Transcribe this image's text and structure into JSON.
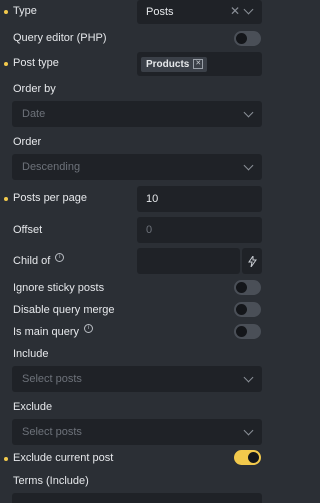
{
  "type": {
    "label": "Type",
    "value": "Posts",
    "clear_icon": "close-icon",
    "chevron": "chevron-down-icon"
  },
  "query_editor": {
    "label": "Query editor (PHP)",
    "enabled": false
  },
  "post_type": {
    "label": "Post type",
    "tag": "Products",
    "tag_remove_icon": "close-icon"
  },
  "order_by": {
    "label": "Order by",
    "placeholder": "Date"
  },
  "order": {
    "label": "Order",
    "placeholder": "Descending"
  },
  "posts_per_page": {
    "label": "Posts per page",
    "value": "10"
  },
  "offset": {
    "label": "Offset",
    "placeholder": "0"
  },
  "child_of": {
    "label": "Child of",
    "info_icon": "info-icon",
    "dynamic_icon": "bolt-icon"
  },
  "ignore_sticky": {
    "label": "Ignore sticky posts",
    "enabled": false
  },
  "disable_merge": {
    "label": "Disable query merge",
    "enabled": false
  },
  "main_query": {
    "label": "Is main query",
    "info_icon": "info-icon",
    "enabled": false
  },
  "include": {
    "label": "Include",
    "placeholder": "Select posts"
  },
  "exclude": {
    "label": "Exclude",
    "placeholder": "Select posts"
  },
  "exclude_current": {
    "label": "Exclude current post",
    "enabled": true
  },
  "terms_include": {
    "label": "Terms (Include)"
  },
  "accent": "#f2c94c"
}
